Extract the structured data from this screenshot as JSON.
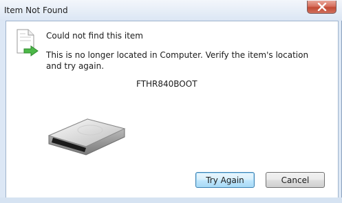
{
  "window": {
    "title": "Item Not Found"
  },
  "message": {
    "heading": "Could not find this item",
    "body": "This is no longer located in Computer. Verify the item's location and try again.",
    "item_name": "FTHR840BOOT"
  },
  "buttons": {
    "try_again": "Try Again",
    "cancel": "Cancel"
  },
  "icons": {
    "close": "close-icon",
    "file": "missing-file-icon",
    "drive": "drive-icon"
  },
  "colors": {
    "close_button": "#c8523c",
    "default_button_border": "#3c7fb1"
  }
}
